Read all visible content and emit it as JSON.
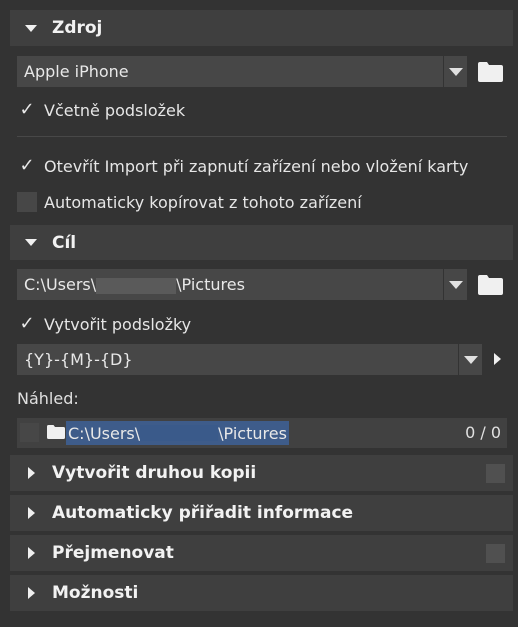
{
  "source": {
    "title": "Zdroj",
    "device_value": "Apple iPhone",
    "include_subfolders_label": "Včetně podsložek",
    "include_subfolders_checked": true,
    "open_import_label": "Otevřít Import při zapnutí zařízení nebo vložení karty",
    "open_import_checked": true,
    "auto_copy_label": "Automaticky kopírovat z tohoto zařízení",
    "auto_copy_checked": false
  },
  "destination": {
    "title": "Cíl",
    "path_prefix": "C:\\Users\\",
    "path_suffix": "\\Pictures",
    "create_subfolders_label": "Vytvořit podsložky",
    "create_subfolders_checked": true,
    "subfolder_pattern": "{Y}-{M}-{D}",
    "preview_label": "Náhled:",
    "preview_path_prefix": "C:\\Users\\",
    "preview_path_suffix": "\\Pictures",
    "preview_count": "0 / 0"
  },
  "collapsed_sections": [
    {
      "title": "Vytvořit druhou kopii",
      "has_checkbox": true
    },
    {
      "title": "Automaticky přiřadit informace",
      "has_checkbox": false
    },
    {
      "title": "Přejmenovat",
      "has_checkbox": true
    },
    {
      "title": "Možnosti",
      "has_checkbox": false
    }
  ],
  "colors": {
    "panel_bg": "#333333",
    "header_bg": "#3f3f3f",
    "control_bg": "#474747",
    "selection": "#3e5c8a"
  },
  "icons": {
    "folder": "folder-icon",
    "dropdown": "chevron-down-icon",
    "expand": "triangle-right-icon",
    "collapse": "triangle-down-icon"
  }
}
